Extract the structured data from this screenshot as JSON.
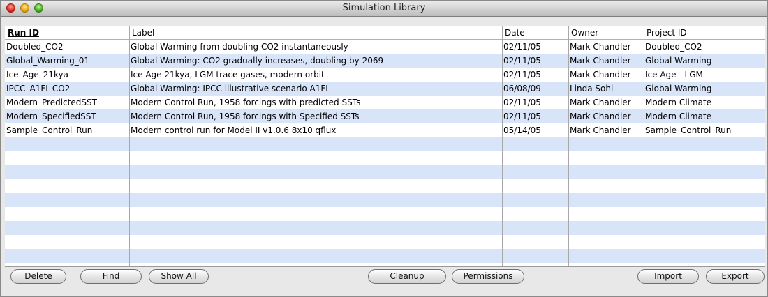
{
  "window": {
    "title": "Simulation Library"
  },
  "table": {
    "columns": [
      "Run ID",
      "Label",
      "Date",
      "Owner",
      "Project ID"
    ],
    "sorted_column": "Run ID",
    "rows": [
      [
        "Doubled_CO2",
        "Global Warming from doubling CO2 instantaneously",
        "02/11/05",
        "Mark Chandler",
        "Doubled_CO2"
      ],
      [
        "Global_Warming_01",
        "Global Warming: CO2 gradually increases, doubling by 2069",
        "02/11/05",
        "Mark Chandler",
        "Global Warming"
      ],
      [
        "Ice_Age_21kya",
        "Ice Age 21kya, LGM trace gases, modern orbit",
        "02/11/05",
        "Mark Chandler",
        "Ice Age - LGM"
      ],
      [
        "IPCC_A1FI_CO2",
        "Global Warming: IPCC illustrative scenario A1FI",
        "06/08/09",
        "Linda Sohl",
        "Global Warming"
      ],
      [
        "Modern_PredictedSST",
        "Modern Control Run, 1958 forcings with predicted SSTs",
        "02/11/05",
        "Mark Chandler",
        "Modern Climate"
      ],
      [
        "Modern_SpecifiedSST",
        "Modern Control Run, 1958 forcings with Specified SSTs",
        "02/11/05",
        "Mark Chandler",
        "Modern Climate"
      ],
      [
        "Sample_Control_Run",
        "Modern control run for Model II v1.0.6 8x10 qflux",
        "05/14/05",
        "Mark Chandler",
        "Sample_Control_Run"
      ]
    ],
    "stripe_color": "#d8e4f8"
  },
  "buttons": {
    "delete": "Delete",
    "find": "Find",
    "show_all": "Show All",
    "cleanup": "Cleanup",
    "permissions": "Permissions",
    "import": "Import",
    "export": "Export"
  }
}
